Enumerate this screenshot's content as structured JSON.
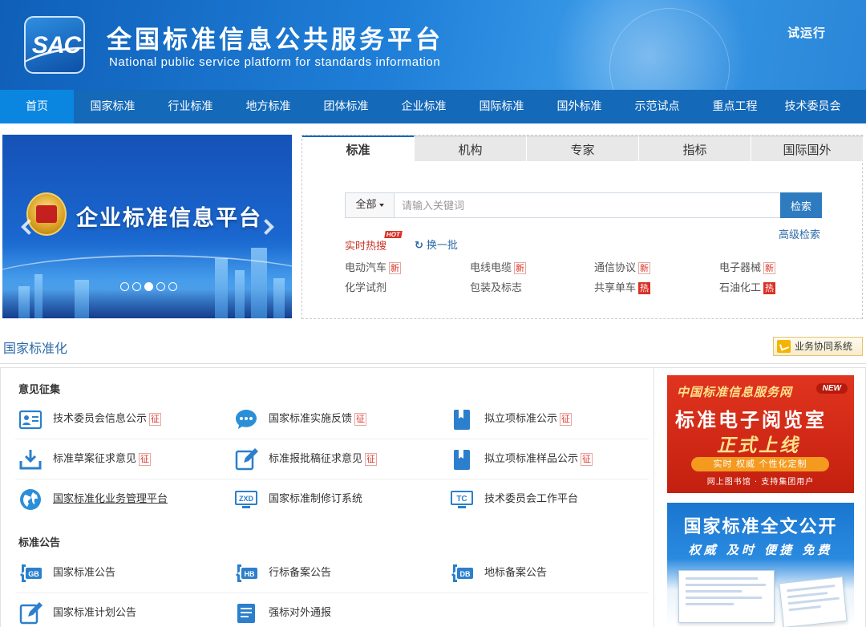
{
  "header": {
    "logo_text": "SAC",
    "title_cn": "全国标准信息公共服务平台",
    "title_en": "National public service platform  for standards information",
    "trial_label": "试运行"
  },
  "nav": {
    "items": [
      "首页",
      "国家标准",
      "行业标准",
      "地方标准",
      "团体标准",
      "企业标准",
      "国际标准",
      "国外标准",
      "示范试点",
      "重点工程",
      "技术委员会"
    ],
    "active_index": 0
  },
  "banner": {
    "title": "企业标准信息平台",
    "slide_count": 5,
    "active_slide": 2
  },
  "search": {
    "tabs": [
      "标准",
      "机构",
      "专家",
      "指标",
      "国际国外"
    ],
    "active_tab": 0,
    "scope_label": "全部",
    "placeholder": "请输入关键词",
    "value": "",
    "button_label": "检索",
    "advanced_label": "高级检索",
    "hot_title": "实时热搜",
    "hot_badge": "HOT",
    "refresh_label": "换一批",
    "hot_items": [
      {
        "text": "电动汽车",
        "tag": "新",
        "tag_type": "new"
      },
      {
        "text": "电线电缆",
        "tag": "新",
        "tag_type": "new"
      },
      {
        "text": "通信协议",
        "tag": "新",
        "tag_type": "new"
      },
      {
        "text": "电子器械",
        "tag": "新",
        "tag_type": "new"
      },
      {
        "text": "化学试剂",
        "tag": "",
        "tag_type": ""
      },
      {
        "text": "包装及标志",
        "tag": "",
        "tag_type": ""
      },
      {
        "text": "共享单车",
        "tag": "热",
        "tag_type": "hot"
      },
      {
        "text": "石油化工",
        "tag": "热",
        "tag_type": "hot"
      }
    ]
  },
  "section": {
    "title": "国家标准化",
    "collab_label": "业务协同系统"
  },
  "groups": {
    "opinion_title": "意见征集",
    "notice_title": "标准公告"
  },
  "links": {
    "tc_info": {
      "label": "技术委员会信息公示",
      "tag": "征"
    },
    "feedback": {
      "label": "国家标准实施反馈",
      "tag": "征"
    },
    "proposed_project": {
      "label": "拟立项标准公示",
      "tag": "征"
    },
    "draft_opinion": {
      "label": "标准草案征求意见",
      "tag": "征"
    },
    "approval_opinion": {
      "label": "标准报批稿征求意见",
      "tag": "征"
    },
    "sample_notice": {
      "label": "拟立项标准样品公示",
      "tag": "征"
    },
    "mgmt_platform": {
      "label": "国家标准化业务管理平台"
    },
    "revision_system": {
      "label": "国家标准制修订系统",
      "icon_text": "ZXD"
    },
    "tc_platform": {
      "label": "技术委员会工作平台",
      "icon_text": "TC"
    },
    "gb_notice": {
      "label": "国家标准公告",
      "icon_text": "GB"
    },
    "hb_notice": {
      "label": "行标备案公告",
      "icon_text": "HB"
    },
    "db_notice": {
      "label": "地标备案公告",
      "icon_text": "DB"
    },
    "plan_notice": {
      "label": "国家标准计划公告"
    },
    "wto_notice": {
      "label": "强标对外通报"
    }
  },
  "ads": {
    "reader": {
      "top": "中国标准信息服务网",
      "new_badge": "NEW",
      "title": "标准电子阅览室",
      "slogan": "正式上线",
      "pill": "实时  权威  个性化定制",
      "footer": "网上图书馆 · 支持集团用户"
    },
    "fulltext": {
      "title": "国家标准全文公开",
      "slogan": "权威 及时 便捷 免费"
    }
  },
  "colors": {
    "nav_bg": "#1469b8",
    "nav_active": "#0b86e0",
    "link_blue": "#2d6aa7",
    "tag_red": "#d93025"
  }
}
